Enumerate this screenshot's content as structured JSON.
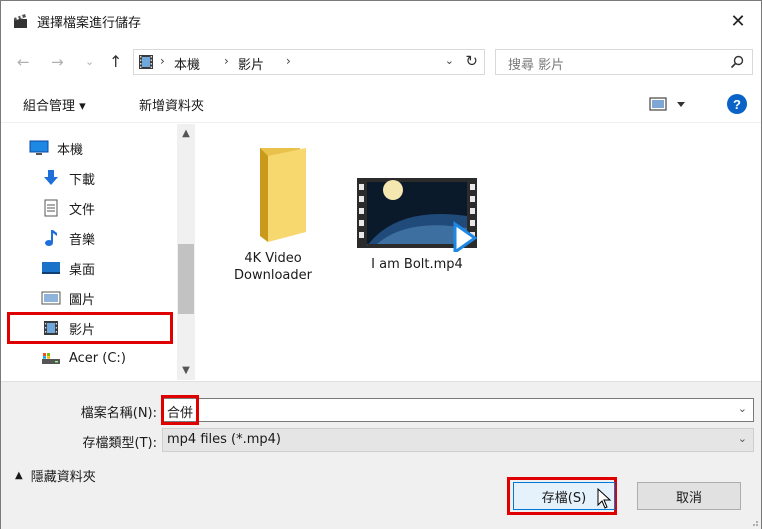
{
  "window": {
    "title": "選擇檔案進行儲存",
    "close_glyph": "✕"
  },
  "nav": {
    "back_glyph": "←",
    "forward_glyph": "→",
    "recent_glyph": "⌄",
    "up_glyph": "↑",
    "breadcrumbs": [
      "本機",
      "影片"
    ],
    "separator": "›",
    "dropdown_glyph": "⌄",
    "refresh_glyph": "↻",
    "search_placeholder": "搜尋 影片"
  },
  "toolbar": {
    "organize_label": "組合管理 ▾",
    "new_folder_label": "新增資料夾",
    "help_label": "?"
  },
  "sidebar": {
    "items": [
      {
        "label": "本機",
        "icon": "computer-icon"
      },
      {
        "label": "下載",
        "icon": "download-icon"
      },
      {
        "label": "文件",
        "icon": "document-icon"
      },
      {
        "label": "音樂",
        "icon": "music-icon"
      },
      {
        "label": "桌面",
        "icon": "desktop-icon"
      },
      {
        "label": "圖片",
        "icon": "pictures-icon"
      },
      {
        "label": "影片",
        "icon": "videos-icon",
        "selected": true
      },
      {
        "label": "Acer (C:)",
        "icon": "drive-icon"
      }
    ],
    "scroll_up": "▲",
    "scroll_down": "▼"
  },
  "files": [
    {
      "name_line1": "4K Video",
      "name_line2": "Downloader",
      "icon": "folder-icon"
    },
    {
      "name_line1": "I am Bolt.mp4",
      "name_line2": "",
      "icon": "video-file-icon"
    }
  ],
  "form": {
    "filename_label": "檔案名稱(N):",
    "filename_value": "合併",
    "filetype_label": "存檔類型(T):",
    "filetype_value": "mp4 files (*.mp4)",
    "combo_glyph": "⌄",
    "hide_folders_label": "隱藏資料夾",
    "hide_folders_glyph": "▲",
    "save_label": "存檔(S)",
    "cancel_label": "取消"
  },
  "colors": {
    "highlight_red": "#e00000",
    "accent_blue": "#0078d7",
    "help_blue": "#0a64c8"
  }
}
